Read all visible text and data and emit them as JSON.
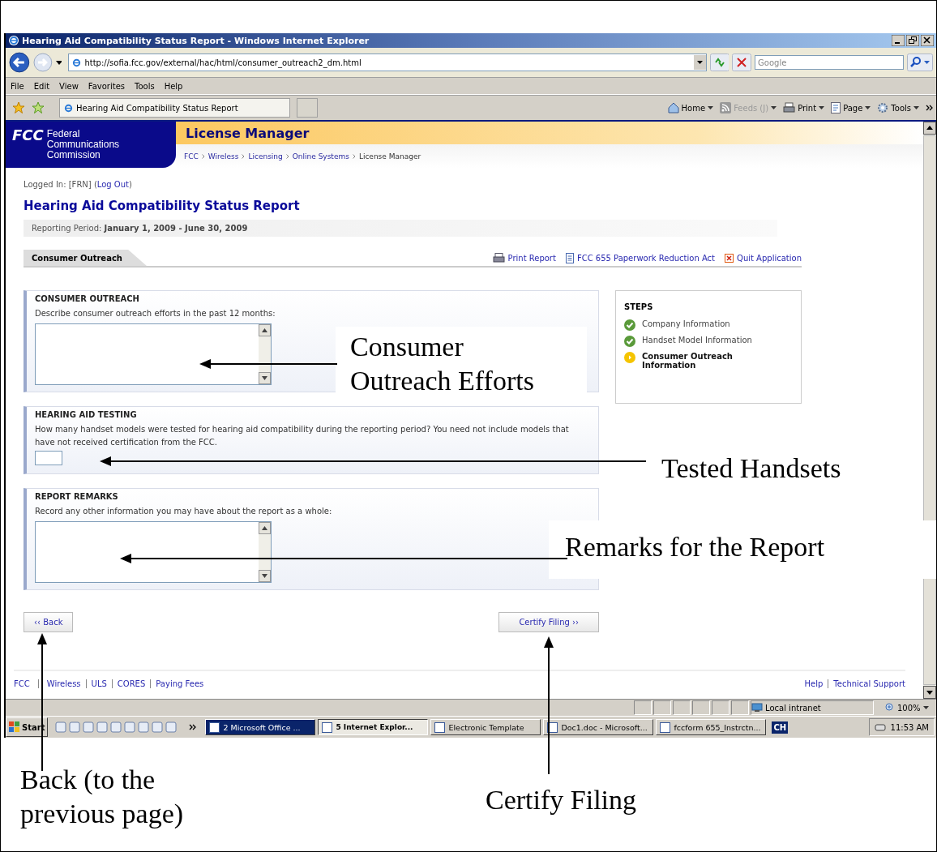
{
  "window": {
    "title": "Hearing Aid Compatibility Status Report - Windows Internet Explorer"
  },
  "address_bar": {
    "url": "http://sofia.fcc.gov/external/hac/html/consumer_outreach2_dm.html"
  },
  "search": {
    "placeholder": "Google"
  },
  "menu": [
    "File",
    "Edit",
    "View",
    "Favorites",
    "Tools",
    "Help"
  ],
  "tabs": [
    {
      "label": "Hearing Aid Compatibility Status Report",
      "selected": true
    }
  ],
  "command_bar": [
    {
      "kind": "home",
      "label": "Home",
      "disabled": false
    },
    {
      "kind": "feeds",
      "label": "Feeds (J)",
      "disabled": true
    },
    {
      "kind": "print",
      "label": "Print",
      "disabled": false
    },
    {
      "kind": "page",
      "label": "Page",
      "disabled": false
    },
    {
      "kind": "tools",
      "label": "Tools",
      "disabled": false
    }
  ],
  "site": {
    "logo": "FCC",
    "agency": "Federal Communications Commission",
    "app_title": "License Manager",
    "breadcrumb": [
      "FCC",
      "Wireless",
      "Licensing",
      "Online Systems",
      "License Manager"
    ]
  },
  "login": {
    "text": "Logged In: [FRN] (",
    "link": "Log Out",
    "after": ")"
  },
  "page_title": "Hearing Aid Compatibility Status Report",
  "reporting_period": {
    "label": "Reporting Period:",
    "value": "January 1, 2009 - June 30, 2009"
  },
  "section_tab": "Consumer Outreach",
  "actions": [
    {
      "kind": "print",
      "label": "Print Report"
    },
    {
      "kind": "document",
      "label": "FCC 655 Paperwork Reduction Act"
    },
    {
      "kind": "quit",
      "label": "Quit Application"
    }
  ],
  "sections": [
    {
      "kind": "textarea",
      "heading": "CONSUMER OUTREACH",
      "prompt": "Describe consumer outreach efforts in the past 12 months:"
    },
    {
      "kind": "input",
      "heading": "HEARING AID TESTING",
      "prompt": "How many handset models were tested for hearing aid compatibility during the reporting period? You need not include models that have not received certification from the FCC."
    },
    {
      "kind": "textarea",
      "heading": "REPORT REMARKS",
      "prompt": "Record any other information you may have about the report as a whole:"
    }
  ],
  "steps": {
    "title": "STEPS",
    "items": [
      {
        "label": "Company Information",
        "completed": true,
        "selected": false
      },
      {
        "label": "Handset Model Information",
        "completed": true,
        "selected": false
      },
      {
        "label": "Consumer Outreach Information",
        "completed": false,
        "selected": true
      }
    ]
  },
  "buttons": [
    {
      "kind": "back",
      "label": "‹‹ Back"
    },
    {
      "kind": "next",
      "label": "Certify Filing ››"
    }
  ],
  "footer_links": [
    "FCC",
    "Wireless",
    "ULS",
    "CORES",
    "Paying Fees"
  ],
  "footer_right": [
    "Help",
    "Technical Support"
  ],
  "status_bar": {
    "zone": "Local intranet",
    "zoom": "100%"
  },
  "taskbar": {
    "start": "Start",
    "tasks": [
      {
        "label": "2 Microsoft Office ...",
        "selected": false,
        "flashing": true
      },
      {
        "label": "5 Internet Explor...",
        "selected": true,
        "flashing": false
      },
      {
        "label": "Electronic Template",
        "selected": false,
        "flashing": false
      },
      {
        "label": "Doc1.doc - Microsoft...",
        "selected": false,
        "flashing": false
      },
      {
        "label": "fccform 655_Instrctn...",
        "selected": false,
        "flashing": false
      }
    ],
    "language": "CH",
    "clock": "11:53 AM"
  },
  "annotations": {
    "outreach": "Consumer Outreach Efforts",
    "tested": "Tested Handsets",
    "remarks": "Remarks for the Report",
    "back": "Back (to the previous page)",
    "certify": "Certify Filing"
  }
}
